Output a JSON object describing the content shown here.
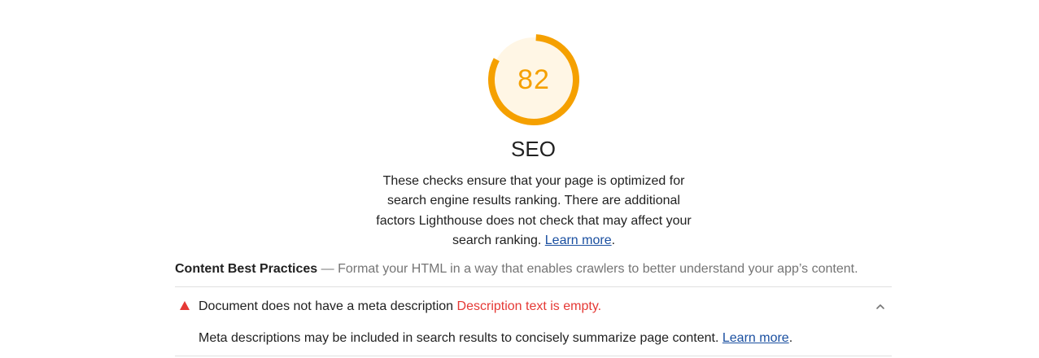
{
  "category": {
    "score": "82",
    "score_fraction": 0.82,
    "score_color": "#f5a000",
    "gauge_fill_color": "#fff6e5",
    "title": "SEO",
    "description": "These checks ensure that your page is optimized for search engine results ranking. There are additional factors Lighthouse does not check that may affect your search ranking.",
    "learn_more": "Learn more",
    "description_end": "."
  },
  "group": {
    "title": "Content Best Practices",
    "separator": "—",
    "description": "Format your HTML in a way that enables crawlers to better understand your app’s content."
  },
  "audit": {
    "status_icon": "fail-triangle-icon",
    "status_color": "#e53935",
    "title": "Document does not have a meta description",
    "display_value": "Description text is empty.",
    "expanded": true,
    "expand_icon": "chevron-up-icon",
    "description": "Meta descriptions may be included in search results to concisely summarize page content.",
    "learn_more": "Learn more",
    "description_end": "."
  }
}
